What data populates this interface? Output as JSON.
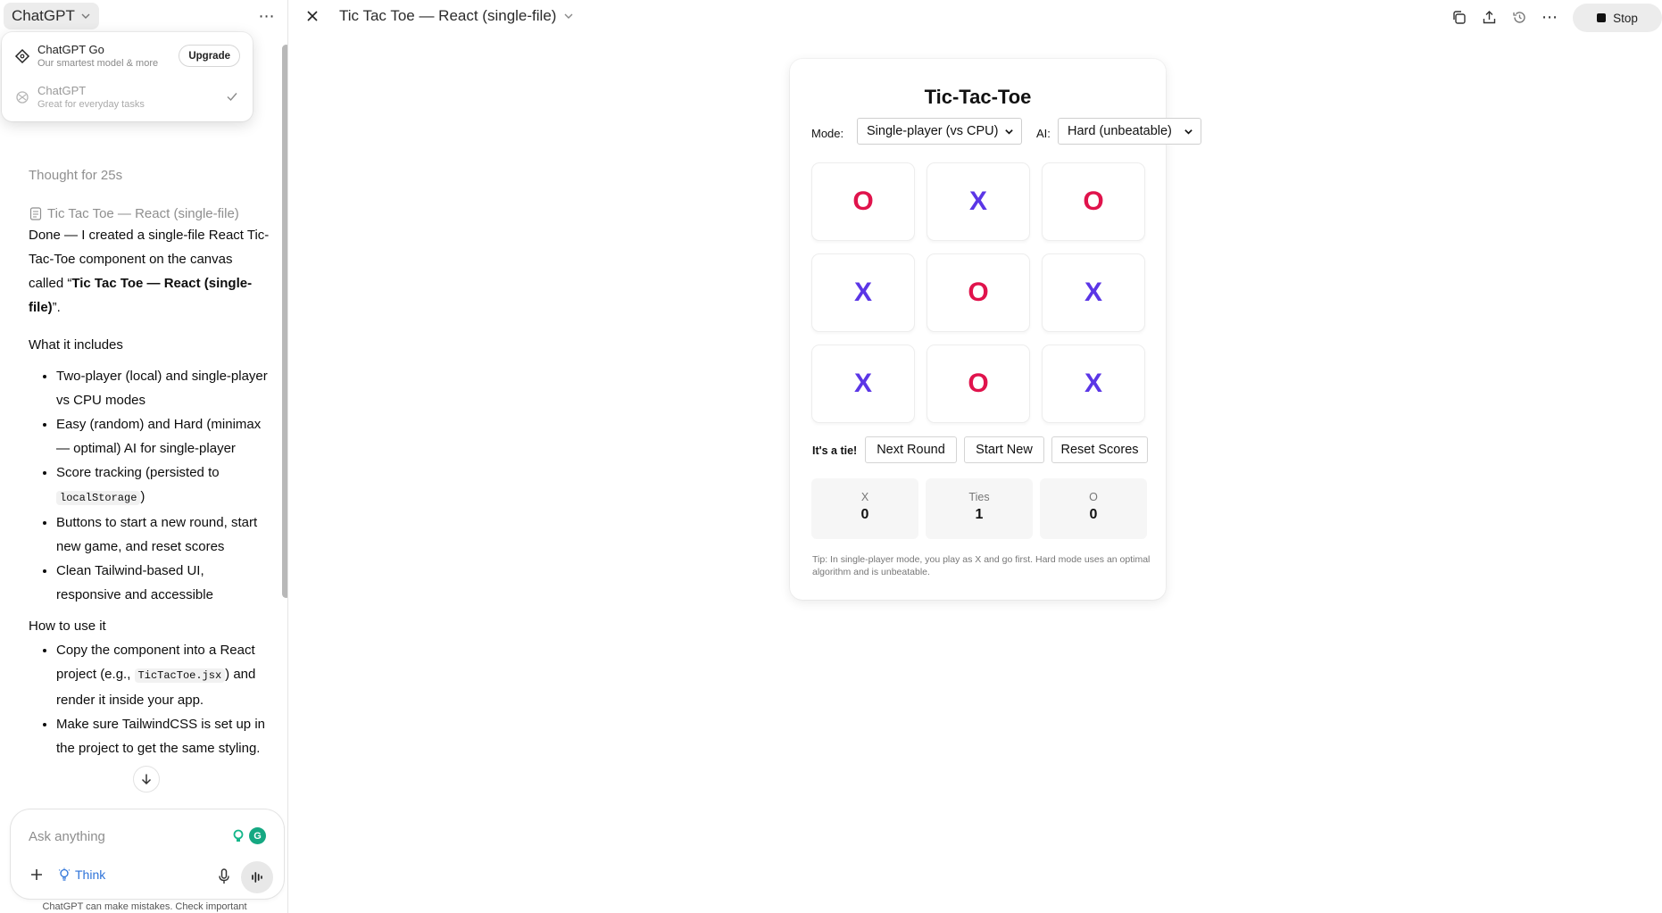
{
  "left_panel": {
    "model_switcher_label": "ChatGPT",
    "model_menu": {
      "items": [
        {
          "title": "ChatGPT Go",
          "subtitle": "Our smartest model & more",
          "action": "Upgrade"
        },
        {
          "title": "ChatGPT",
          "subtitle": "Great for everyday tasks"
        }
      ]
    },
    "thought_label": "Thought for 25s",
    "doc_reference": "Tic Tac Toe — React (single-file)",
    "message": {
      "intro_prefix": "Done — I created a single-file React Tic-Tac-Toe component on the canvas called “",
      "intro_bold": "Tic Tac Toe — React (single-file)",
      "intro_suffix": "”.",
      "includes_heading": "What it includes",
      "includes": [
        "Two-player (local) and single-player vs CPU modes",
        "Easy (random) and Hard (minimax — optimal) AI for single-player",
        "Buttons to start a new round, start new game, and reset scores",
        "Clean Tailwind-based UI, responsive and accessible"
      ],
      "score_prefix": "Score tracking (persisted to ",
      "score_code": "localStorage",
      "score_suffix": ")",
      "howto_heading": "How to use it",
      "copy_prefix": "Copy the component into a React project (e.g., ",
      "copy_code": "TicTacToe.jsx",
      "copy_suffix": ") and render it inside your app.",
      "tailwind_item": "Make sure TailwindCSS is set up in the project to get the same styling."
    },
    "composer": {
      "placeholder": "Ask anything",
      "think_label": "Think"
    },
    "disclaimer": "ChatGPT can make mistakes. Check important info."
  },
  "canvas": {
    "title": "Tic Tac Toe — React (single-file)",
    "stop_label": "Stop"
  },
  "game": {
    "title": "Tic-Tac-Toe",
    "mode_label": "Mode:",
    "mode_value": "Single-player (vs CPU)",
    "ai_label": "AI:",
    "ai_value": "Hard (unbeatable)",
    "board": [
      "O",
      "X",
      "O",
      "X",
      "O",
      "X",
      "X",
      "O",
      "X"
    ],
    "status": "It's a tie!",
    "buttons": {
      "next_round": "Next Round",
      "start_new": "Start New",
      "reset_scores": "Reset Scores"
    },
    "scores": [
      {
        "label": "X",
        "value": "0"
      },
      {
        "label": "Ties",
        "value": "1"
      },
      {
        "label": "O",
        "value": "0"
      }
    ],
    "tip": "Tip: In single-player mode, you play as X and go first. Hard mode uses an optimal algorithm and is unbeatable."
  },
  "colors": {
    "x_mark": "#5b36e6",
    "o_mark": "#e0134c",
    "think_accent": "#2d73d9"
  }
}
